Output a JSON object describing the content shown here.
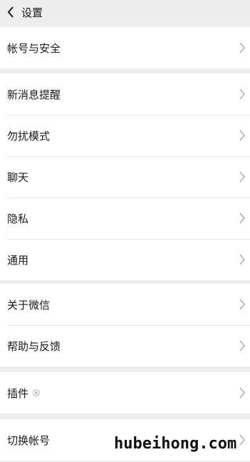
{
  "header": {
    "back_icon": "chevron-left-icon",
    "title": "设置"
  },
  "groups": [
    {
      "items": [
        {
          "label": "帐号与安全",
          "icon": "chevron-right-icon"
        }
      ]
    },
    {
      "items": [
        {
          "label": "新消息提醒",
          "icon": "chevron-right-icon"
        },
        {
          "label": "勿扰模式",
          "icon": "chevron-right-icon"
        },
        {
          "label": "聊天",
          "icon": "chevron-right-icon"
        },
        {
          "label": "隐私",
          "icon": "chevron-right-icon"
        },
        {
          "label": "通用",
          "icon": "chevron-right-icon"
        }
      ]
    },
    {
      "items": [
        {
          "label": "关于微信",
          "icon": "chevron-right-icon"
        },
        {
          "label": "帮助与反馈",
          "icon": "chevron-right-icon"
        }
      ]
    },
    {
      "items": [
        {
          "label": "插件",
          "sub_icon": "hexagon-icon",
          "icon": "chevron-right-icon"
        }
      ]
    },
    {
      "items": [
        {
          "label": "切换帐号",
          "icon": "chevron-right-icon"
        }
      ]
    }
  ],
  "watermark": "hubeihong.com",
  "colors": {
    "background": "#ededed",
    "row_background": "#ffffff",
    "text": "#1a1a1a",
    "chevron": "#b2b2b2"
  }
}
